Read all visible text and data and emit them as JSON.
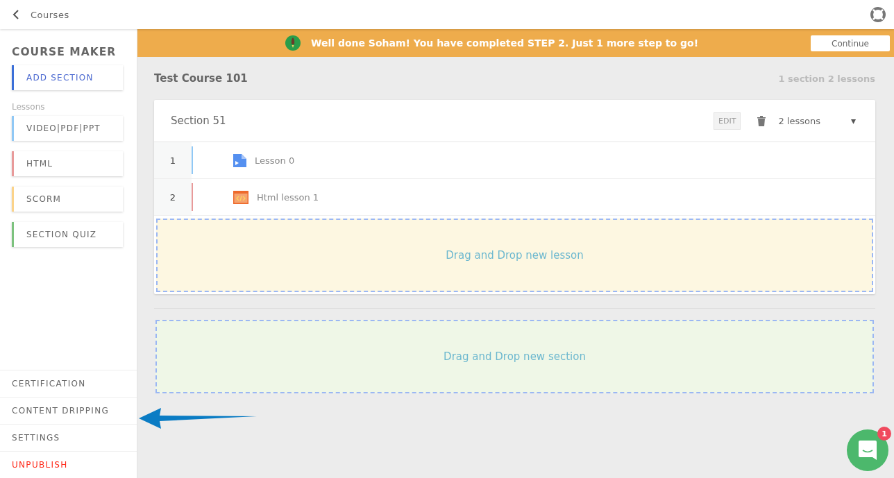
{
  "topbar": {
    "back_label": "Courses"
  },
  "sidebar": {
    "title": "COURSE MAKER",
    "add_button": {
      "label": "ADD SECTION",
      "color": "#3b6fd8"
    },
    "lessons_label": "Lessons",
    "lesson_types": [
      {
        "label": "VIDEO|PDF|PPT",
        "color": "#90c8f5"
      },
      {
        "label": "HTML",
        "color": "#e89a9a"
      },
      {
        "label": "SCORM",
        "color": "#fbd38a"
      },
      {
        "label": "SECTION QUIZ",
        "color": "#7cc27e"
      }
    ],
    "nav": [
      {
        "label": "CERTIFICATION",
        "kind": "normal"
      },
      {
        "label": "CONTENT DRIPPING",
        "kind": "normal"
      },
      {
        "label": "SETTINGS",
        "kind": "normal"
      },
      {
        "label": "UNPUBLISH",
        "kind": "danger"
      }
    ]
  },
  "banner": {
    "message": "Well done Soham! You have completed STEP 2. Just 1 more step to go!",
    "button": "Continue"
  },
  "course": {
    "title": "Test Course 101",
    "summary": "1 section 2 lessons"
  },
  "section": {
    "title": "Section 51",
    "edit": "EDIT",
    "count": "2 lessons",
    "caret": "▾",
    "lessons": [
      {
        "number": "1",
        "title": "Lesson 0",
        "kind": "video",
        "color": "#90c8f5"
      },
      {
        "number": "2",
        "title": "Html lesson 1",
        "kind": "html",
        "color": "#e89a9a"
      }
    ],
    "drop_hint": "Drag and Drop new lesson"
  },
  "section_drop_hint": "Drag and Drop new section",
  "chat": {
    "badge": "1"
  }
}
